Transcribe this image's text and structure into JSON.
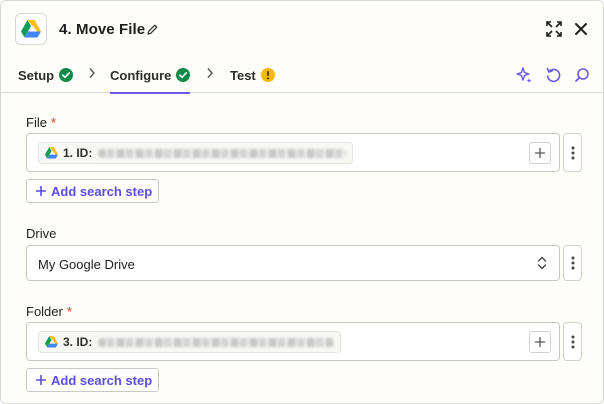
{
  "header": {
    "title": "4. Move File",
    "app_icon": "google-drive-icon",
    "edit_icon": "pencil-icon",
    "expand_icon": "expand-icon",
    "close_icon": "close-icon"
  },
  "tabs": [
    {
      "label": "Setup",
      "status": "complete",
      "status_icon": "check-circle-icon"
    },
    {
      "label": "Configure",
      "status": "complete",
      "status_icon": "check-circle-icon",
      "active": true
    },
    {
      "label": "Test",
      "status": "warning",
      "status_icon": "warning-circle-icon"
    }
  ],
  "toolbar": {
    "icons": [
      "sparkle-icon",
      "refresh-icon",
      "search-icon"
    ]
  },
  "fields": {
    "file": {
      "label": "File",
      "required_mark": "*",
      "chip_label": "1. ID:",
      "add_step_label": "Add search step"
    },
    "drive": {
      "label": "Drive",
      "value": "My Google Drive"
    },
    "folder": {
      "label": "Folder",
      "required_mark": "*",
      "chip_label": "3. ID:",
      "add_step_label": "Add search step"
    }
  },
  "colors": {
    "accent": "#695be8",
    "success": "#138a4a",
    "warning": "#f2b90c",
    "required": "#e0321c"
  }
}
